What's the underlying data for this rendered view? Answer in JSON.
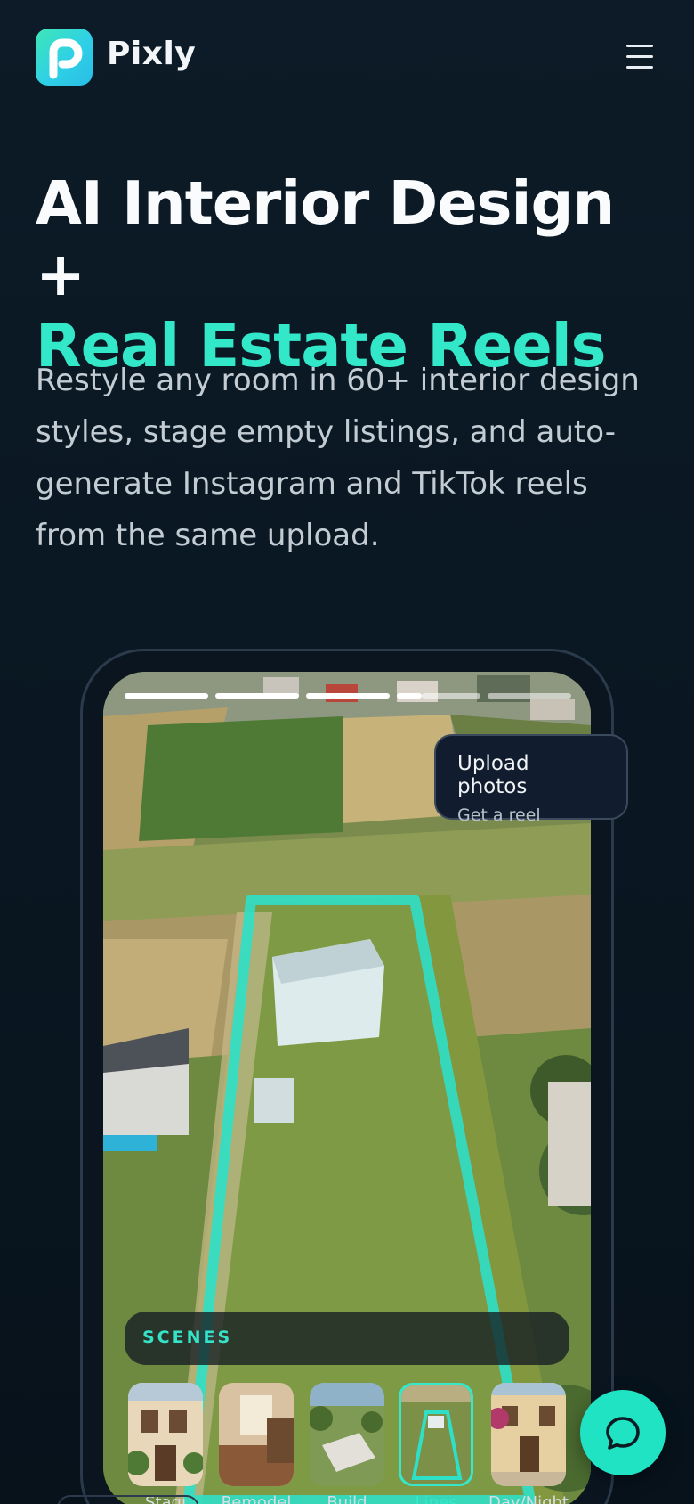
{
  "header": {
    "brand": "Pixly",
    "logo_letter": "P",
    "menu_icon": "hamburger-icon"
  },
  "hero": {
    "title_line1": "AI Interior Design +",
    "title_line2": "Real Estate Reels",
    "subtitle": "Restyle any room in 60+ interior design styles, stage empty listings, and auto-generate Instagram and TikTok reels from the same upload."
  },
  "phone": {
    "story_progress": [
      1,
      1,
      1,
      0.3,
      0
    ],
    "upload_card": {
      "title": "Upload photos",
      "subtitle": "Get a reel"
    },
    "scenes": {
      "label": "SCENES",
      "items": [
        {
          "label": "Stagi",
          "active": false
        },
        {
          "label": "Remodel",
          "active": false
        },
        {
          "label": "Build",
          "active": false
        },
        {
          "label": "Lines",
          "active": true
        },
        {
          "label": "Day/Night",
          "active": false
        }
      ]
    }
  },
  "chat": {
    "icon": "chat-bubble-icon"
  },
  "colors": {
    "accent": "#33e7c9",
    "background": "#0c1b27",
    "card": "#111d2e",
    "parcel_outline": "#2fe0c8"
  }
}
